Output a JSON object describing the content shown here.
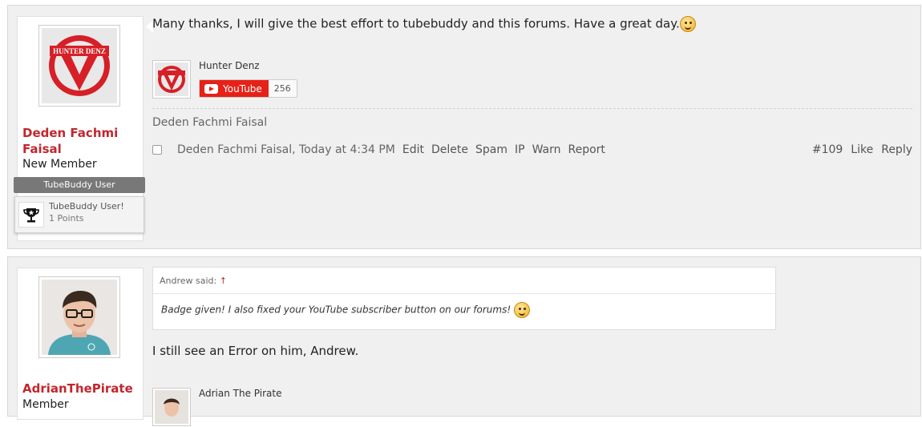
{
  "colors": {
    "username": "#c1272d",
    "banner_bg": "#787878",
    "youtube_red": "#e62117",
    "post_bg": "#f0f0f0"
  },
  "post1": {
    "username_line1": "Deden Fachmi",
    "username_line2": "Faisal",
    "user_title": "New Member",
    "banner": "TubeBuddy User",
    "trophy_title": "TubeBuddy User!",
    "trophy_points": "1 Points",
    "avatar_text": "HUNTER DENZ",
    "message": "Many thanks, I will give the best effort to tubebuddy and this forums. Have a great day.",
    "signature": {
      "channel_name": "Hunter Denz",
      "youtube_label": "YouTube",
      "subscriber_count": "256"
    },
    "signature_text": "Deden Fachmi Faisal",
    "meta": {
      "author_time": "Deden Fachmi Faisal, Today at 4:34 PM",
      "edit": "Edit",
      "delete": "Delete",
      "spam": "Spam",
      "ip": "IP",
      "warn": "Warn",
      "report": "Report",
      "post_number": "#109",
      "like": "Like",
      "reply": "Reply"
    }
  },
  "post2": {
    "username": "AdrianThePirate",
    "user_title": "Member",
    "quote_author": "Andrew said:",
    "quote_arrow": "↑",
    "quote_text": "Badge given! I also fixed your YouTube subscriber button on our forums!",
    "message": "I still see an Error on him, Andrew.",
    "signature": {
      "channel_name": "Adrian The Pirate"
    }
  }
}
